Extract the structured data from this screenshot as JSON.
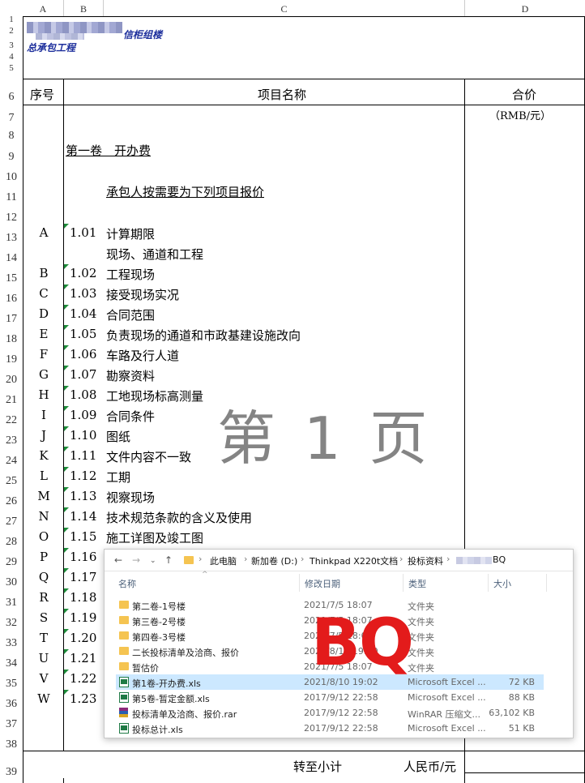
{
  "columns": {
    "a": "A",
    "b": "B",
    "c": "C",
    "d": "D"
  },
  "rows": [
    "1",
    "2",
    "3",
    "4",
    "5",
    "6",
    "7",
    "8",
    "9",
    "10",
    "11",
    "12",
    "13",
    "14",
    "15",
    "16",
    "17",
    "18",
    "19",
    "20",
    "21",
    "22",
    "23",
    "24",
    "25",
    "26",
    "27",
    "28",
    "29",
    "30",
    "31",
    "32",
    "33",
    "34",
    "35",
    "36",
    "37",
    "38",
    "39"
  ],
  "title": {
    "line2_suffix": "信柜组楼",
    "line3": "总承包工程"
  },
  "table_header": {
    "seq": "序号",
    "item": "项目名称",
    "price": "合价",
    "unit": "（RMB/元）"
  },
  "volume_title": "第一卷　开办费",
  "intro": "承包人按需要为下列项目报价",
  "items": [
    {
      "letter": "A",
      "num": "1.01",
      "name": "计算期限"
    },
    {
      "letter": "",
      "num": "",
      "name": "现场、通道和工程"
    },
    {
      "letter": "B",
      "num": "1.02",
      "name": "工程现场"
    },
    {
      "letter": "C",
      "num": "1.03",
      "name": "接受现场实况"
    },
    {
      "letter": "D",
      "num": "1.04",
      "name": "合同范围"
    },
    {
      "letter": "E",
      "num": "1.05",
      "name": "负责现场的通道和市政基建设施改向"
    },
    {
      "letter": "F",
      "num": "1.06",
      "name": "车路及行人道"
    },
    {
      "letter": "G",
      "num": "1.07",
      "name": "勘察资料"
    },
    {
      "letter": "H",
      "num": "1.08",
      "name": "工地现场标高测量"
    },
    {
      "letter": "I",
      "num": "1.09",
      "name": "合同条件"
    },
    {
      "letter": "J",
      "num": "1.10",
      "name": "图纸"
    },
    {
      "letter": "K",
      "num": "1.11",
      "name": "文件内容不一致"
    },
    {
      "letter": "L",
      "num": "1.12",
      "name": "工期"
    },
    {
      "letter": "M",
      "num": "1.13",
      "name": "视察现场"
    },
    {
      "letter": "N",
      "num": "1.14",
      "name": "技术规范条款的含义及使用"
    },
    {
      "letter": "O",
      "num": "1.15",
      "name": "施工详图及竣工图"
    },
    {
      "letter": "P",
      "num": "1.16",
      "name": ""
    },
    {
      "letter": "Q",
      "num": "1.17",
      "name": ""
    },
    {
      "letter": "R",
      "num": "1.18",
      "name": ""
    },
    {
      "letter": "S",
      "num": "1.19",
      "name": ""
    },
    {
      "letter": "T",
      "num": "1.20",
      "name": ""
    },
    {
      "letter": "U",
      "num": "1.21",
      "name": ""
    },
    {
      "letter": "V",
      "num": "1.22",
      "name": ""
    },
    {
      "letter": "W",
      "num": "1.23",
      "name": ""
    }
  ],
  "footer": {
    "carry": "转至小计",
    "currency": "人民币/元"
  },
  "watermark": "第 1 页",
  "overlay_text": "BQ",
  "explorer": {
    "breadcrumb": [
      "此电脑",
      "新加卷 (D:)",
      "Thinkpad X220t文档",
      "投标资料",
      "BQ"
    ],
    "columns": {
      "name": "名称",
      "date": "修改日期",
      "type": "类型",
      "size": "大小"
    },
    "files": [
      {
        "name": "第二卷-1号楼",
        "date": "2021/7/5 18:07",
        "type": "文件夹",
        "size": "",
        "icon": "folder-icon",
        "selected": false
      },
      {
        "name": "第三卷-2号楼",
        "date": "2021/7/5 18:07",
        "type": "文件夹",
        "size": "",
        "icon": "folder-icon",
        "selected": false
      },
      {
        "name": "第四卷-3号楼",
        "date": "2021/7/5 18:07",
        "type": "文件夹",
        "size": "",
        "icon": "folder-icon",
        "selected": false
      },
      {
        "name": "二长投标清单及洽商、报价",
        "date": "2021/8/10 19:20",
        "type": "文件夹",
        "size": "",
        "icon": "folder-icon",
        "selected": false
      },
      {
        "name": "暂估价",
        "date": "2021/7/5 18:07",
        "type": "文件夹",
        "size": "",
        "icon": "folder-icon",
        "selected": false
      },
      {
        "name": "第1卷-开办费.xls",
        "date": "2021/8/10 19:02",
        "type": "Microsoft Excel ...",
        "size": "72 KB",
        "icon": "excel-file-icon",
        "selected": true
      },
      {
        "name": "第5卷-暂定金额.xls",
        "date": "2017/9/12 22:58",
        "type": "Microsoft Excel ...",
        "size": "88 KB",
        "icon": "excel-file-icon",
        "selected": false
      },
      {
        "name": "投标清单及洽商、报价.rar",
        "date": "2017/9/12 22:58",
        "type": "WinRAR 压缩文...",
        "size": "63,102 KB",
        "icon": "rar-archive-icon",
        "selected": false
      },
      {
        "name": "投标总计.xls",
        "date": "2017/9/12 22:58",
        "type": "Microsoft Excel ...",
        "size": "51 KB",
        "icon": "excel-file-icon",
        "selected": false
      }
    ]
  }
}
